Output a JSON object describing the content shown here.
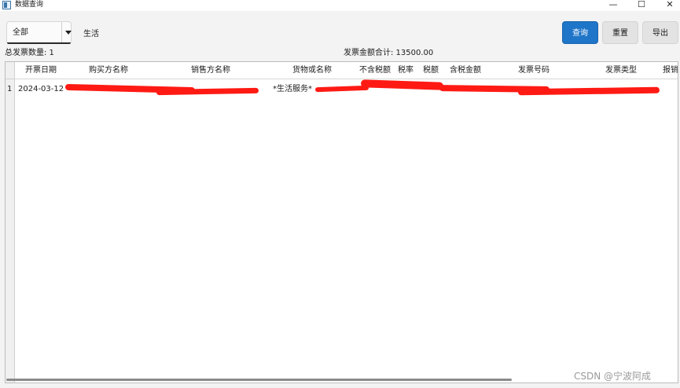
{
  "window": {
    "title": "数据查询",
    "controls": {
      "minimize": "—",
      "maximize": "☐",
      "close": "✕"
    }
  },
  "toolbar": {
    "filter_selected": "全部",
    "search_value": "生活",
    "query_label": "查询",
    "reset_label": "重置",
    "export_label": "导出"
  },
  "summary": {
    "count_text": "总发票数量: 1",
    "total_text": "发票金额合计: 13500.00"
  },
  "table": {
    "columns": [
      "开票日期",
      "购买方名称",
      "销售方名称",
      "货物或名称",
      "不含税额",
      "税率",
      "税额",
      "含税金额",
      "发票号码",
      "发票类型",
      "报销"
    ],
    "rows": [
      {
        "index": "1",
        "date": "2024-03-12",
        "goods": "*生活服务*"
      }
    ]
  },
  "colors": {
    "accent": "#1f75c8",
    "redaction": "#ff1a14"
  },
  "watermark": "CSDN @宁波阿成"
}
